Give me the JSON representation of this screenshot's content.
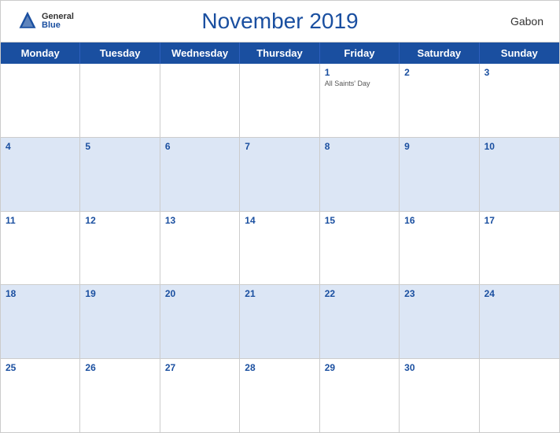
{
  "header": {
    "month_year": "November 2019",
    "country": "Gabon",
    "logo_general": "General",
    "logo_blue": "Blue"
  },
  "day_headers": [
    "Monday",
    "Tuesday",
    "Wednesday",
    "Thursday",
    "Friday",
    "Saturday",
    "Sunday"
  ],
  "weeks": [
    {
      "shaded": false,
      "days": [
        {
          "number": "",
          "empty": true
        },
        {
          "number": "",
          "empty": true
        },
        {
          "number": "",
          "empty": true
        },
        {
          "number": "",
          "empty": true
        },
        {
          "number": "1",
          "event": "All Saints' Day"
        },
        {
          "number": "2"
        },
        {
          "number": "3"
        }
      ]
    },
    {
      "shaded": true,
      "days": [
        {
          "number": "4"
        },
        {
          "number": "5"
        },
        {
          "number": "6"
        },
        {
          "number": "7"
        },
        {
          "number": "8"
        },
        {
          "number": "9"
        },
        {
          "number": "10"
        }
      ]
    },
    {
      "shaded": false,
      "days": [
        {
          "number": "11"
        },
        {
          "number": "12"
        },
        {
          "number": "13"
        },
        {
          "number": "14"
        },
        {
          "number": "15"
        },
        {
          "number": "16"
        },
        {
          "number": "17"
        }
      ]
    },
    {
      "shaded": true,
      "days": [
        {
          "number": "18"
        },
        {
          "number": "19"
        },
        {
          "number": "20"
        },
        {
          "number": "21"
        },
        {
          "number": "22"
        },
        {
          "number": "23"
        },
        {
          "number": "24"
        }
      ]
    },
    {
      "shaded": false,
      "days": [
        {
          "number": "25"
        },
        {
          "number": "26"
        },
        {
          "number": "27"
        },
        {
          "number": "28"
        },
        {
          "number": "29"
        },
        {
          "number": "30"
        },
        {
          "number": "",
          "empty": true
        }
      ]
    }
  ]
}
